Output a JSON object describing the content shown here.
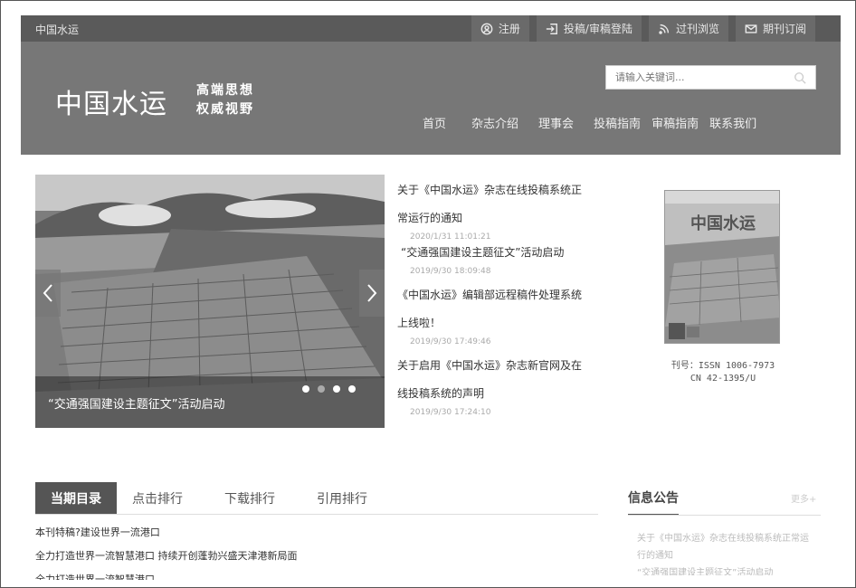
{
  "topbar": {
    "site_name": "中国水运",
    "buttons": [
      {
        "label": "注册",
        "icon": "user-circle-icon"
      },
      {
        "label": "投稿/审稿登陆",
        "icon": "login-icon"
      },
      {
        "label": "过刊浏览",
        "icon": "rss-icon"
      },
      {
        "label": "期刊订阅",
        "icon": "envelope-icon"
      }
    ]
  },
  "header": {
    "logo": "中国水运",
    "slogan_line1": "高端思想",
    "slogan_line2": "权威视野",
    "search_placeholder": "请输入关键词...",
    "nav": [
      "首页",
      "杂志介绍",
      "理事会",
      "投稿指南",
      "审稿指南",
      "联系我们"
    ]
  },
  "carousel": {
    "caption": "“交通强国建设主题征文”活动启动",
    "dots_total": 4,
    "active_dot": 2
  },
  "news": [
    {
      "title": "关于《中国水运》杂志在线投稿系统正常运行的通知",
      "date": "2020/1/31 11:01:21"
    },
    {
      "title": "“交通强国建设主题征文”活动启动",
      "date": "2019/9/30 18:09:48"
    },
    {
      "title": "《中国水运》编辑部远程稿件处理系统上线啦！",
      "date": "2019/9/30 17:49:46"
    },
    {
      "title": "关于启用《中国水运》杂志新官网及在线投稿系统的声明",
      "date": "2019/9/30 17:24:10"
    }
  ],
  "journal": {
    "cover_title": "中国水运",
    "issn_line": "刊号：ISSN 1006-7973",
    "cn_line": "CN 42-1395/U"
  },
  "tabs": [
    "当期目录",
    "点击排行",
    "下载排行",
    "引用排行"
  ],
  "articles": [
    "本刊特稿?建设世界一流港口",
    "全力打造世界一流智慧港口 持续开创蓬勃兴盛天津港新局面",
    "全力打造世界一流智慧港口"
  ],
  "notice": {
    "title": "信息公告",
    "more": "更多+",
    "items": [
      "关于《中国水运》杂志在线投稿系统正常运行的通知",
      "“交通强国建设主题征文”活动启动"
    ]
  },
  "colors": {
    "topbar": "#5a5a5a",
    "header": "#777777",
    "active_tab": "#555555"
  }
}
